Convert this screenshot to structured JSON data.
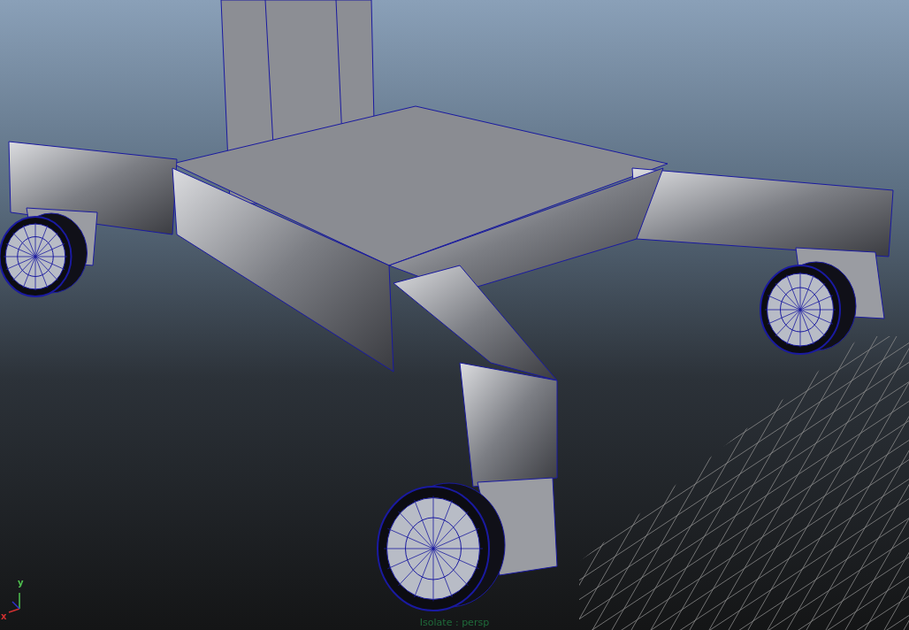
{
  "viewport": {
    "camera_label": "Isolate : persp",
    "axis_labels": [
      "y",
      "x"
    ]
  }
}
